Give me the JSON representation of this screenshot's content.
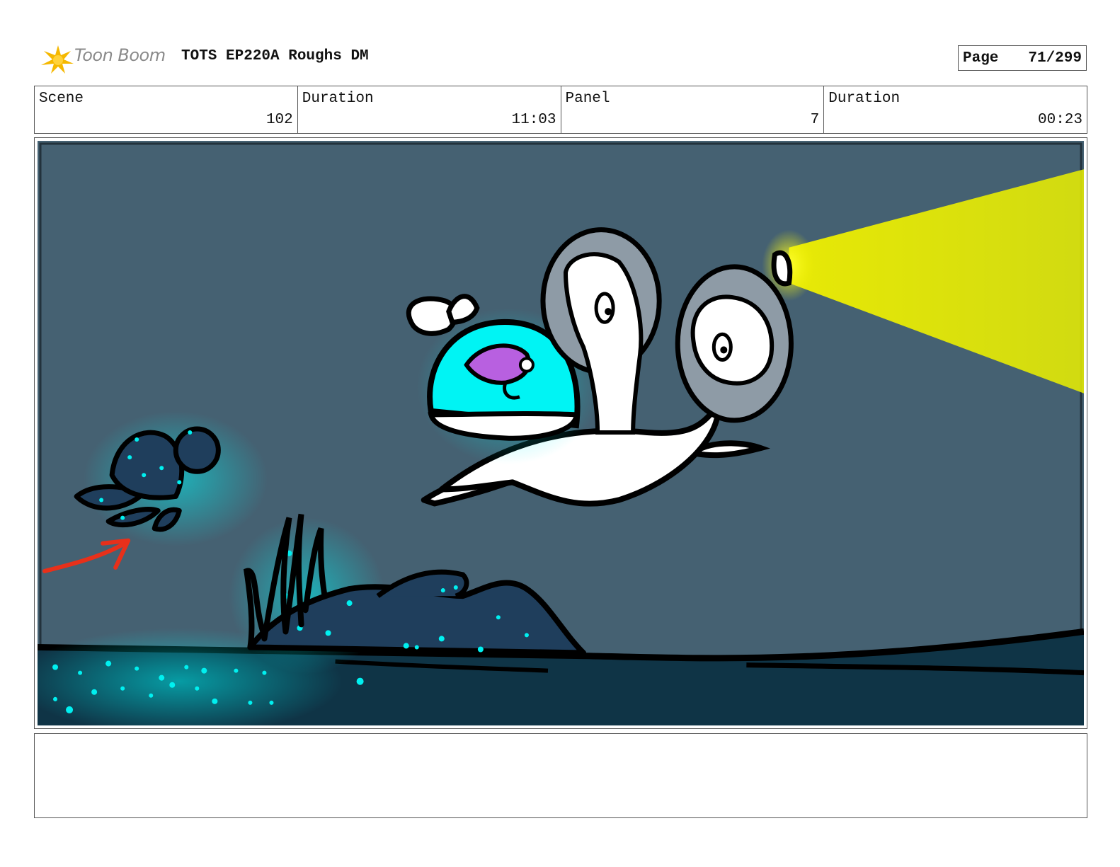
{
  "header": {
    "logo_text": "Toon Boom",
    "title": "TOTS EP220A Roughs DM",
    "page_label": "Page",
    "page_value": "71/299"
  },
  "info": [
    {
      "label": "Scene",
      "value": "102"
    },
    {
      "label": "Duration",
      "value": "11:03"
    },
    {
      "label": "Panel",
      "value": "7"
    },
    {
      "label": "Duration",
      "value": "00:23"
    }
  ],
  "panel": {
    "background_color": "#456172",
    "seafloor_color": "#0f3446",
    "glow_color": "#00f0f0",
    "light_beam_color": "#f0f000",
    "arrow_color": "#e8301a"
  },
  "notes": {
    "text": ""
  }
}
